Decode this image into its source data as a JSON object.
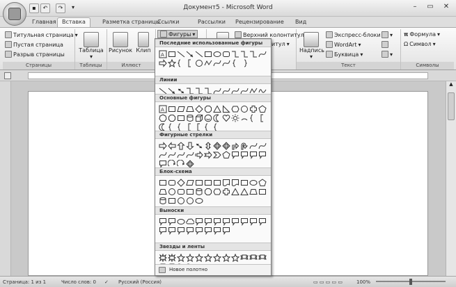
{
  "window": {
    "title": "Документ5 - Microsoft Word",
    "min": "–",
    "max": "▭",
    "close": "✕"
  },
  "tabs": [
    {
      "label": "Главная"
    },
    {
      "label": "Вставка",
      "active": true
    },
    {
      "label": "Разметка страницы"
    },
    {
      "label": "Ссылки"
    },
    {
      "label": "Рассылки"
    },
    {
      "label": "Рецензирование"
    },
    {
      "label": "Вид"
    }
  ],
  "ribbon": {
    "pages": {
      "cover": "Титульная страница",
      "blank": "Пустая страница",
      "break": "Разрыв страницы",
      "group": "Страницы"
    },
    "tables": {
      "table": "Таблица",
      "group": "Таблицы"
    },
    "illustrations": {
      "picture": "Рисунок",
      "clip": "Клип",
      "shapes": "Фигуры",
      "group": "Иллюст"
    },
    "header": {
      "label": "Верхний колонтитул",
      "footer": "итул"
    },
    "text": {
      "textbox": "Надпись",
      "express": "Экспресс-блоки",
      "wordart": "WordArt",
      "dropcap": "Буквица",
      "group": "Текст"
    },
    "symbols": {
      "formula": "Формула",
      "symbol": "Символ",
      "group": "Символы"
    }
  },
  "shapes_menu": {
    "sections": [
      {
        "title": "Последние использованные фигуры",
        "shapes": [
          "text",
          "rect",
          "line",
          "arrow",
          "line",
          "rect",
          "oval",
          "round",
          "elbow",
          "elbow",
          "elbow",
          "curve",
          "arrow-r",
          "star",
          "brace",
          "bracket",
          "circle",
          "free",
          "curve",
          "curve",
          "brace-l",
          "brace-r"
        ]
      },
      {
        "title": "Линии",
        "shapes": [
          "line",
          "arrow",
          "darrow",
          "elbow",
          "elbow",
          "elbow",
          "curve",
          "curve",
          "curve",
          "curve",
          "free",
          "scribble"
        ]
      },
      {
        "title": "Основные фигуры",
        "shapes": [
          "text",
          "rect",
          "para",
          "trap",
          "diamond",
          "oct",
          "tri",
          "rtri",
          "hex",
          "circle",
          "cross",
          "pent",
          "hept",
          "oct",
          "rect",
          "cyl",
          "cube",
          "smile",
          "moon",
          "heart",
          "sun",
          "arc",
          "brace",
          "bracket",
          "moon",
          "brace",
          "brace",
          "bracket",
          "bracket",
          "brace",
          "brace"
        ]
      },
      {
        "title": "Фигурные стрелки",
        "shapes": [
          "arrow-r",
          "arrow-l",
          "arrow-u",
          "arrow-d",
          "darrow",
          "arrow-ud",
          "quad",
          "quad",
          "bent",
          "uturn",
          "curve",
          "curve",
          "curve",
          "curve",
          "curve",
          "curve",
          "striped",
          "notched",
          "chevron",
          "pent",
          "callout",
          "callout",
          "callout",
          "callout",
          "callout",
          "circ",
          "circ",
          "quad"
        ]
      },
      {
        "title": "Блок-схема",
        "shapes": [
          "rect",
          "round",
          "diamond",
          "para",
          "rect",
          "rect",
          "rect",
          "doc",
          "doc",
          "rect",
          "oval",
          "pent",
          "trap",
          "circle",
          "round",
          "rect",
          "cyl",
          "oct",
          "hex",
          "cross",
          "tri",
          "tri",
          "trap",
          "rect",
          "cyl",
          "rect",
          "circle",
          "circle",
          "oval"
        ]
      },
      {
        "title": "Выноски",
        "shapes": [
          "callout",
          "callout",
          "oval",
          "cloud",
          "callout",
          "callout",
          "callout",
          "callout",
          "callout",
          "callout",
          "callout",
          "callout",
          "callout",
          "callout",
          "callout",
          "callout",
          "callout",
          "callout",
          "callout",
          "callout"
        ]
      },
      {
        "title": "Звезды и ленты",
        "shapes": [
          "burst",
          "burst",
          "star",
          "star",
          "star",
          "star",
          "star",
          "star",
          "star",
          "ribbon",
          "ribbon",
          "ribbon",
          "ribbon",
          "ribbon",
          "wave",
          "wave"
        ]
      }
    ],
    "new_canvas": "Новое полотно"
  },
  "status": {
    "page": "Страница: 1 из 1",
    "words": "Число слов: 0",
    "language": "Русский (Россия)",
    "zoom": "100%"
  }
}
